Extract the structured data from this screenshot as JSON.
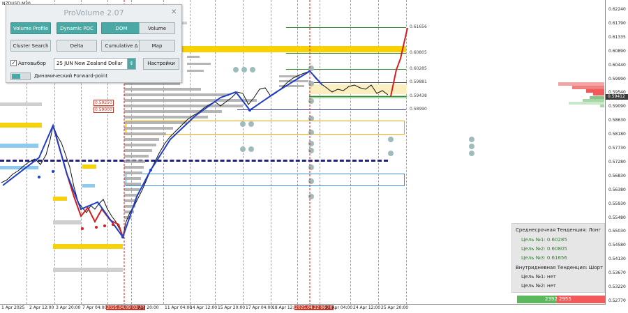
{
  "symbol": "NZDUSD,M30",
  "panel": {
    "title": "ProVolume 2.07",
    "close_glyph": "✕",
    "buttons": [
      {
        "label": "Volume Profile",
        "active": true
      },
      {
        "label": "Dynamic POC",
        "active": true
      },
      {
        "label": "DOM",
        "active": true
      },
      {
        "label": "Volume",
        "active": false
      },
      {
        "label": "Cluster Search",
        "active": false
      },
      {
        "label": "Delta",
        "active": false
      },
      {
        "label": "Cumulative Δ",
        "active": false
      },
      {
        "label": "Map",
        "active": false
      }
    ],
    "autoselect_label": "Автовыбор",
    "autoselect_checked": true,
    "symbol_select_value": "25 JUN New Zealand Dollar",
    "settings_label": "Настройки",
    "forward_point_label": "Динамический Forward-point",
    "accent_color": "#4aa9a4"
  },
  "price_axis": {
    "ticks": [
      "0.62240",
      "0.61790",
      "0.61335",
      "0.60890",
      "0.60440",
      "0.59990",
      "0.59540",
      "0.59090",
      "0.58630",
      "0.58180",
      "0.57730",
      "0.57280",
      "0.56830",
      "0.56380",
      "0.55930",
      "0.55480",
      "0.55030",
      "0.54580",
      "0.54130",
      "0.53670",
      "0.53220",
      "0.52770"
    ],
    "current": "0.59412"
  },
  "time_axis": {
    "labels": [
      {
        "text": "1 Apr 2025",
        "hl": false
      },
      {
        "text": "2 Apr 12:00",
        "hl": false
      },
      {
        "text": "3 Apr 20:00",
        "hl": false
      },
      {
        "text": "7 Apr 04:00",
        "hl": false
      },
      {
        "text": "2025.04.09 03:00",
        "hl": true
      },
      {
        "text": "Apr 20:00",
        "hl": false
      },
      {
        "text": "11 Apr 04:00",
        "hl": false
      },
      {
        "text": "14 Apr 12:00",
        "hl": false
      },
      {
        "text": "15 Apr 20:00",
        "hl": false
      },
      {
        "text": "17 Apr 04:00",
        "hl": false
      },
      {
        "text": "18 Apr 12:00",
        "hl": false
      },
      {
        "text": "2025.04.22 06:30",
        "hl": true
      },
      {
        "text": "23 Apr 04:00",
        "hl": false
      },
      {
        "text": "24 Apr 12:00",
        "hl": false
      },
      {
        "text": "25 Apr 20:00",
        "hl": false
      }
    ]
  },
  "levels": {
    "l1": "0.61656",
    "l2": "0.60805",
    "l3": "0.60285",
    "l4": "0.59881",
    "l5": "0.59438",
    "l6": "0.58990",
    "red1": "0.59250",
    "red2": "0.59000"
  },
  "info": {
    "mid_trend": "Среднесрочная Тенденция: Лонг",
    "mid_targets": [
      "Цель №1:  0.60285",
      "Цель №2:  0.60805",
      "Цель №3:  0.61656"
    ],
    "intraday_trend": "Внутридневная Тенденция: Шорт",
    "intraday_targets": [
      "Цель №1:  нет",
      "Цель №2:  нет"
    ]
  },
  "balance": {
    "buy": "2392",
    "sell": "2955",
    "buy_fraction": 0.447
  }
}
